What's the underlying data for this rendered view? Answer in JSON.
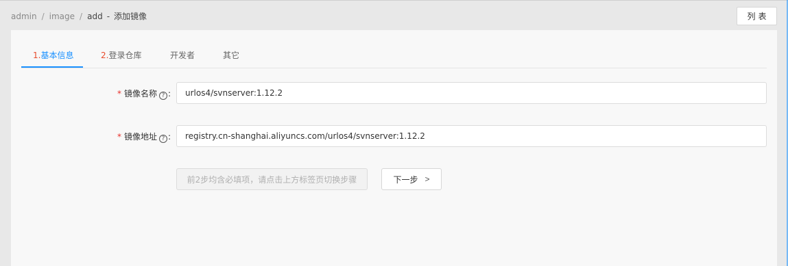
{
  "breadcrumb": {
    "items": [
      "admin",
      "image",
      "add"
    ],
    "separator": "/",
    "dash": "-",
    "title": "添加镜像"
  },
  "header": {
    "list_button": "列表"
  },
  "tabs": [
    {
      "num": "1.",
      "label": "基本信息",
      "active": true
    },
    {
      "num": "2.",
      "label": "登录仓库",
      "active": false
    },
    {
      "num": "",
      "label": "开发者",
      "active": false
    },
    {
      "num": "",
      "label": "其它",
      "active": false
    }
  ],
  "form": {
    "required_mark": "*",
    "help_icon": "?",
    "colon": ":",
    "image_name": {
      "label": "镜像名称",
      "value": "urlos4/svnserver:1.12.2"
    },
    "image_address": {
      "label": "镜像地址",
      "value": "registry.cn-shanghai.aliyuncs.com/urlos4/svnserver:1.12.2"
    },
    "hint_button": "前2步均含必填项，请点击上方标签页切换步骤",
    "next_button": "下一步",
    "next_icon": ">"
  },
  "colors": {
    "accent": "#1890ff",
    "required": "#e8302b",
    "step_number": "#e84a2b"
  }
}
